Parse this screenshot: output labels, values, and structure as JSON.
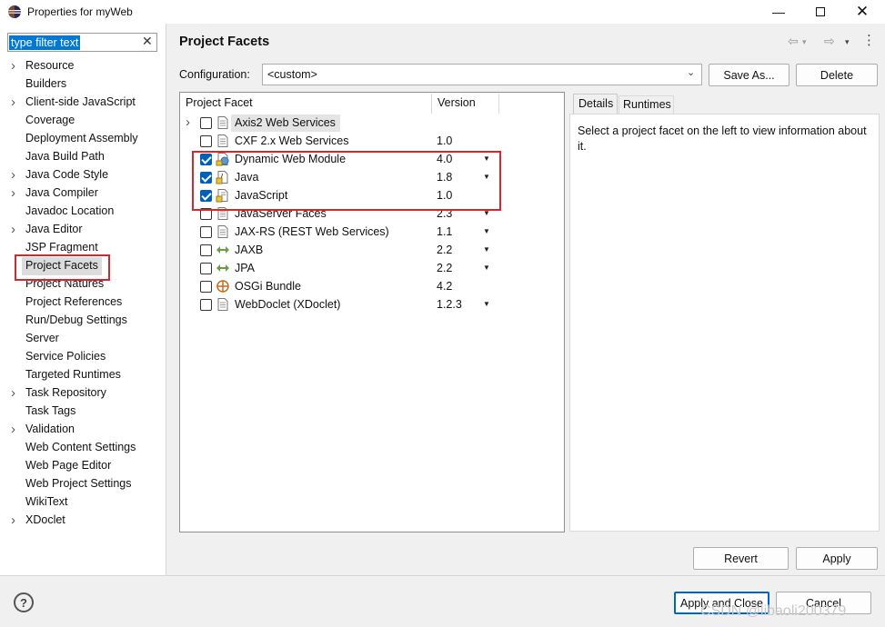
{
  "window": {
    "title": "Properties for myWeb",
    "controls": [
      "minimize-icon",
      "maximize-icon",
      "close-icon"
    ]
  },
  "filter": {
    "value": "type filter text"
  },
  "nav": {
    "items": [
      {
        "label": "Resource",
        "expandable": true
      },
      {
        "label": "Builders",
        "expandable": false
      },
      {
        "label": "Client-side JavaScript",
        "expandable": true
      },
      {
        "label": "Coverage",
        "expandable": false
      },
      {
        "label": "Deployment Assembly",
        "expandable": false
      },
      {
        "label": "Java Build Path",
        "expandable": false
      },
      {
        "label": "Java Code Style",
        "expandable": true
      },
      {
        "label": "Java Compiler",
        "expandable": true
      },
      {
        "label": "Javadoc Location",
        "expandable": false
      },
      {
        "label": "Java Editor",
        "expandable": true
      },
      {
        "label": "JSP Fragment",
        "expandable": false
      },
      {
        "label": "Project Facets",
        "expandable": false,
        "selected": true
      },
      {
        "label": "Project Natures",
        "expandable": false
      },
      {
        "label": "Project References",
        "expandable": false
      },
      {
        "label": "Run/Debug Settings",
        "expandable": false
      },
      {
        "label": "Server",
        "expandable": false
      },
      {
        "label": "Service Policies",
        "expandable": false
      },
      {
        "label": "Targeted Runtimes",
        "expandable": false
      },
      {
        "label": "Task Repository",
        "expandable": true
      },
      {
        "label": "Task Tags",
        "expandable": false
      },
      {
        "label": "Validation",
        "expandable": true
      },
      {
        "label": "Web Content Settings",
        "expandable": false
      },
      {
        "label": "Web Page Editor",
        "expandable": false
      },
      {
        "label": "Web Project Settings",
        "expandable": false
      },
      {
        "label": "WikiText",
        "expandable": false
      },
      {
        "label": "XDoclet",
        "expandable": true
      }
    ]
  },
  "page": {
    "title": "Project Facets"
  },
  "config": {
    "label": "Configuration:",
    "value": "<custom>",
    "save_as": "Save As...",
    "delete": "Delete"
  },
  "facets": {
    "col_facet": "Project Facet",
    "col_version": "Version",
    "rows": [
      {
        "name": "Axis2 Web Services",
        "version": "",
        "checked": false,
        "expandable": true,
        "dropdown": false,
        "icon": "page-icon"
      },
      {
        "name": "CXF 2.x Web Services",
        "version": "1.0",
        "checked": false,
        "expandable": false,
        "dropdown": false,
        "icon": "page-icon"
      },
      {
        "name": "Dynamic Web Module",
        "version": "4.0",
        "checked": true,
        "expandable": false,
        "dropdown": true,
        "icon": "web-module-icon"
      },
      {
        "name": "Java",
        "version": "1.8",
        "checked": true,
        "expandable": false,
        "dropdown": true,
        "icon": "java-locked-icon"
      },
      {
        "name": "JavaScript",
        "version": "1.0",
        "checked": true,
        "expandable": false,
        "dropdown": false,
        "icon": "javascript-locked-icon"
      },
      {
        "name": "JavaServer Faces",
        "version": "2.3",
        "checked": false,
        "expandable": false,
        "dropdown": true,
        "icon": "page-icon"
      },
      {
        "name": "JAX-RS (REST Web Services)",
        "version": "1.1",
        "checked": false,
        "expandable": false,
        "dropdown": true,
        "icon": "page-icon"
      },
      {
        "name": "JAXB",
        "version": "2.2",
        "checked": false,
        "expandable": false,
        "dropdown": true,
        "icon": "arrows-icon"
      },
      {
        "name": "JPA",
        "version": "2.2",
        "checked": false,
        "expandable": false,
        "dropdown": true,
        "icon": "arrows-icon"
      },
      {
        "name": "OSGi Bundle",
        "version": "4.2",
        "checked": false,
        "expandable": false,
        "dropdown": false,
        "icon": "osgi-icon"
      },
      {
        "name": "WebDoclet (XDoclet)",
        "version": "1.2.3",
        "checked": false,
        "expandable": false,
        "dropdown": true,
        "icon": "page-icon"
      }
    ]
  },
  "details": {
    "tabs": [
      "Details",
      "Runtimes"
    ],
    "text": "Select a project facet on the left to view information about it."
  },
  "buttons": {
    "revert": "Revert",
    "apply": "Apply",
    "apply_close": "Apply and Close",
    "cancel": "Cancel"
  },
  "watermark": "CSDN @libaoli200379",
  "colors": {
    "highlight_red": "#d7262f",
    "checkbox_blue": "#005fb8",
    "selection_blue": "#0078d7"
  }
}
